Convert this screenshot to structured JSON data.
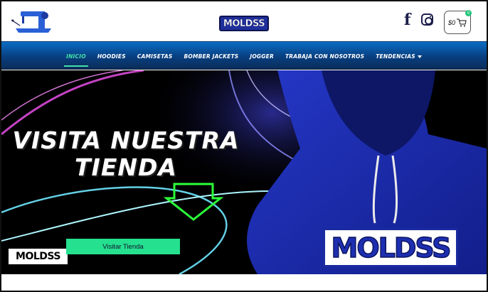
{
  "header": {
    "brand": "MOLDSS",
    "cart": {
      "amount": "$0",
      "count": "0"
    }
  },
  "nav": {
    "items": [
      {
        "label": "Inicio",
        "active": true
      },
      {
        "label": "Hoodies"
      },
      {
        "label": "Camisetas"
      },
      {
        "label": "Bomber Jackets"
      },
      {
        "label": "Jogger"
      },
      {
        "label": "Trabaja con nosotros"
      },
      {
        "label": "Tendencias"
      }
    ]
  },
  "hero": {
    "headline_line1": "VISITA NUESTRA",
    "headline_line2": "TIENDA",
    "cta_label": "Visitar Tienda",
    "brand_small": "MOLDSS",
    "hoodie_print": "MOLDSS"
  },
  "colors": {
    "accent": "#25e08e",
    "nav": "#084a8f",
    "hoodie": "#1b2db5"
  }
}
